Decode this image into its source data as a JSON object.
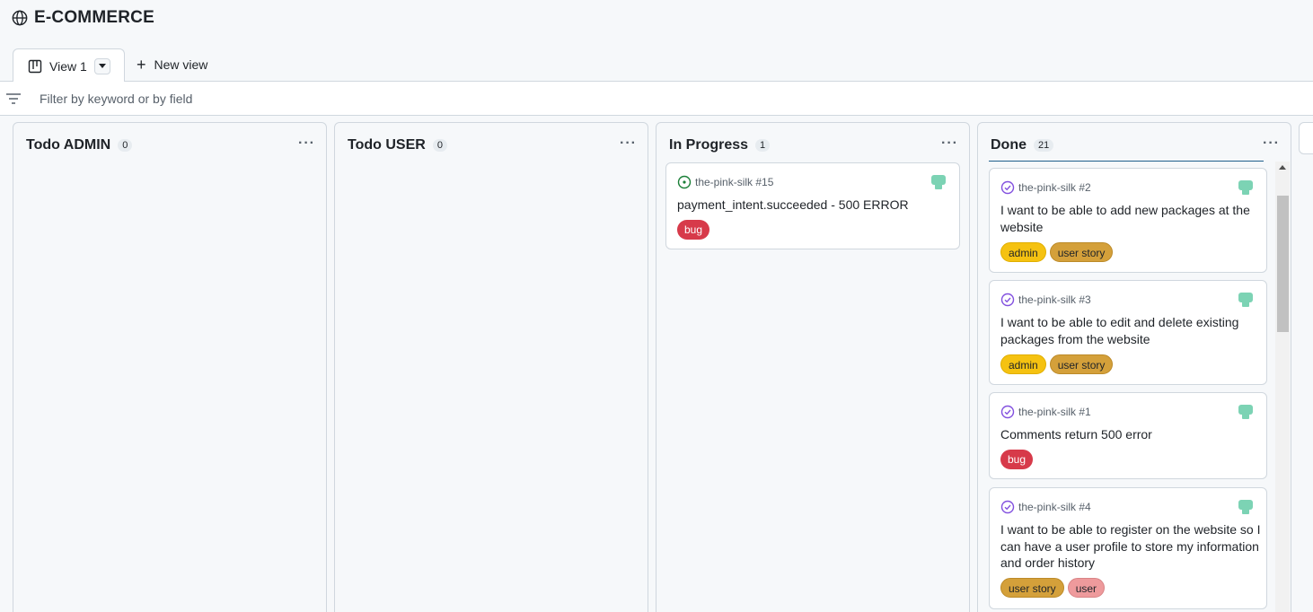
{
  "project": {
    "title": "E-COMMERCE"
  },
  "tabs": {
    "active": "View 1",
    "new_view": "New view"
  },
  "filter": {
    "placeholder": "Filter by keyword or by field"
  },
  "columns": [
    {
      "name": "Todo ADMIN",
      "count": "0"
    },
    {
      "name": "Todo USER",
      "count": "0"
    },
    {
      "name": "In Progress",
      "count": "1",
      "cards": [
        {
          "repo": "the-pink-silk #15",
          "title": "payment_intent.succeeded - 500 ERROR",
          "labels": [
            "bug"
          ],
          "status": "open"
        }
      ]
    },
    {
      "name": "Done",
      "count": "21",
      "cards": [
        {
          "repo": "the-pink-silk #2",
          "title": "I want to be able to add new packages at the website",
          "labels": [
            "admin",
            "user story"
          ],
          "status": "closed"
        },
        {
          "repo": "the-pink-silk #3",
          "title": "I want to be able to edit and delete existing packages from the website",
          "labels": [
            "admin",
            "user story"
          ],
          "status": "closed"
        },
        {
          "repo": "the-pink-silk #1",
          "title": "Comments return 500 error",
          "labels": [
            "bug"
          ],
          "status": "closed"
        },
        {
          "repo": "the-pink-silk #4",
          "title": "I want to be able to register on the website so I can have a user profile to store my information and order history",
          "labels": [
            "user story",
            "user"
          ],
          "status": "closed"
        }
      ]
    }
  ],
  "colors": {
    "open_status": "#1a7f37",
    "closed_status": "#8250df",
    "avatar": "#7cd3b4",
    "bug": "#d73a4a",
    "admin": "#f5c211",
    "user_story": "#d4a03a",
    "user": "#ee9a9c"
  },
  "icons": {
    "project": "globe-icon",
    "view": "board-icon",
    "filter": "filter-icon",
    "column_menu": "kebab-icon",
    "open": "issue-opened-icon",
    "closed": "issue-closed-icon"
  }
}
